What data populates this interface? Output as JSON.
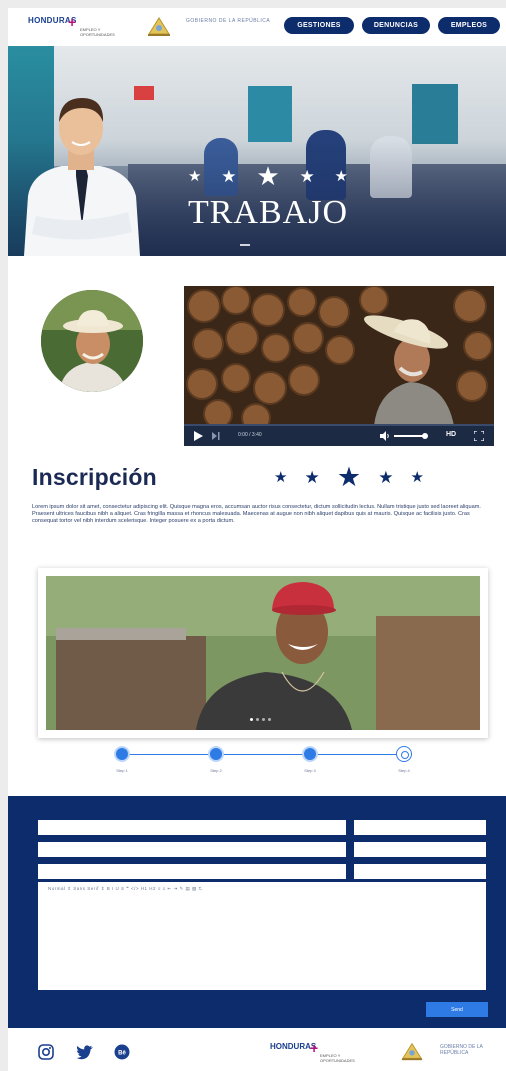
{
  "header": {
    "logo_text": "HONDURAS",
    "logo_plus": "+",
    "logo_tagline": "EMPLEO Y OPORTUNIDADES",
    "gov_text": "GOBIERNO DE LA REPÚBLICA",
    "nav": [
      {
        "label": "GESTIONES"
      },
      {
        "label": "DENUNCIAS"
      },
      {
        "label": "EMPLEOS"
      }
    ]
  },
  "hero": {
    "title": "TRABAJO",
    "stars": [
      "★",
      "★",
      "★",
      "★",
      "★"
    ]
  },
  "video": {
    "time": "0:00 / 3:40",
    "quality": "HD"
  },
  "inscripcion": {
    "title": "Inscripción",
    "stars": [
      "★",
      "★",
      "★",
      "★",
      "★"
    ],
    "body": "Lorem ipsum dolor sit amet, consectetur adipiscing elit. Quisque magna eros, accumsan auctor risus consectetur, dictum sollicitudin lectus. Nullam tristique justo sed laoreet aliquam. Praesent ultrices faucibus nibh a aliquet. Cras fringilla massa et rhoncus malesuada. Maecenas at augue non nibh aliquet dapibus quis at mauris. Quisque ac facilisis justo. Cras consequat tortor vel nibh interdum scelerisque. Integer posuere ex a porta dictum."
  },
  "stepper": {
    "steps": [
      {
        "label": "Step 1"
      },
      {
        "label": "Step 2"
      },
      {
        "label": "Step 3"
      },
      {
        "label": "Step 4"
      }
    ]
  },
  "form": {
    "toolbar": "Normal  ⇕  Sans Serif  ⇕   B  I  U  S  ❝  </>   H1  H2  ≡  ≡  ⇤  ⇥   ✎  ▤  ▧   T̶",
    "send_label": "Send"
  },
  "footer": {
    "logo_text": "HONDURAS",
    "logo_plus": "+",
    "logo_tagline": "EMPLEO Y OPORTUNIDADES",
    "gov_text": "GOBIERNO DE LA REPÚBLICA"
  },
  "colors": {
    "navy": "#0d2c6c",
    "accent_blue": "#2f7be6",
    "magenta": "#b8127b"
  }
}
